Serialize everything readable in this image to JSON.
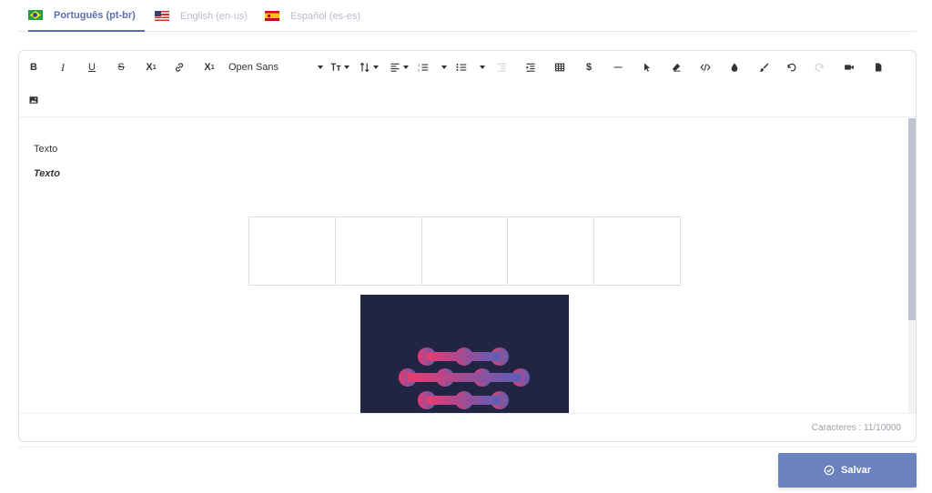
{
  "tabs": [
    {
      "label": "Português (pt-br)",
      "flag": "brazil-flag-icon",
      "active": true
    },
    {
      "label": "English (en-us)",
      "flag": "usa-flag-icon",
      "active": false
    },
    {
      "label": "Español (es-es)",
      "flag": "spain-flag-icon",
      "active": false
    }
  ],
  "toolbar": {
    "bold": "B",
    "italic": "I",
    "underline": "U",
    "strike": "S",
    "subscript": "X",
    "subscript_mark": "1",
    "superscript": "X",
    "superscript_mark": "1",
    "font": "Open Sans",
    "special_char": "$"
  },
  "content": {
    "paragraph_1": "Texto",
    "paragraph_2": "Texto",
    "table": {
      "rows": 1,
      "columns": 5
    }
  },
  "status": {
    "char_count": "Caracteres : 11/10000"
  },
  "actions": {
    "save_label": "Salvar"
  },
  "colors": {
    "accent": "#5a6fae",
    "button": "#6b82be",
    "image_bg": "#212542",
    "logo_pink": "#e83a6f",
    "logo_blue": "#5a5fb8"
  }
}
